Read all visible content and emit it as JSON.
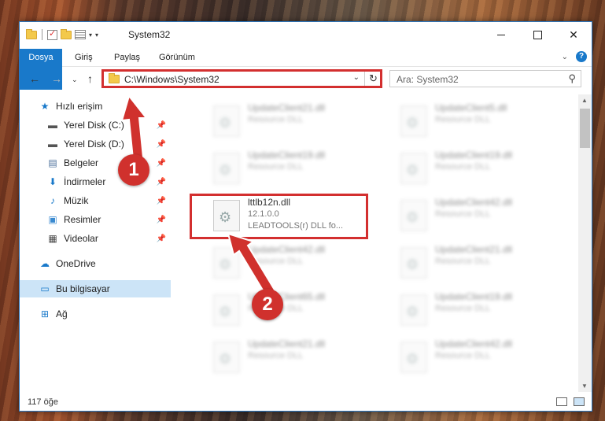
{
  "window": {
    "title": "System32",
    "accent": "#1979ca",
    "highlight": "#d32f2f"
  },
  "ribbon": {
    "tabs": [
      "Dosya",
      "Giriş",
      "Paylaş",
      "Görünüm"
    ],
    "help": "?"
  },
  "nav": {
    "address": "C:\\Windows\\System32",
    "search_placeholder": "Ara: System32"
  },
  "sidebar": {
    "items": [
      {
        "label": "Hızlı erişim",
        "icon": "star-icon"
      },
      {
        "label": "Yerel Disk (C:)",
        "icon": "drive-icon"
      },
      {
        "label": "Yerel Disk (D:)",
        "icon": "drive-icon"
      },
      {
        "label": "Belgeler",
        "icon": "documents-icon"
      },
      {
        "label": "İndirmeler",
        "icon": "download-icon"
      },
      {
        "label": "Müzik",
        "icon": "music-icon"
      },
      {
        "label": "Resimler",
        "icon": "pictures-icon"
      },
      {
        "label": "Videolar",
        "icon": "video-icon"
      },
      {
        "label": "OneDrive",
        "icon": "cloud-icon"
      },
      {
        "label": "Bu bilgisayar",
        "icon": "computer-icon"
      },
      {
        "label": "Ağ",
        "icon": "network-icon"
      }
    ]
  },
  "files": [
    {
      "name": "UpdateClient21.dll",
      "desc": "Resource DLL"
    },
    {
      "name": "UpdateClient5.dll",
      "desc": "Resource DLL"
    },
    {
      "name": "UpdateClient19.dll",
      "desc": "Resource DLL"
    },
    {
      "name": "UpdateClient19.dll",
      "desc": "Resource DLL"
    },
    {
      "name": "lttlb12n.dll",
      "desc": "12.1.0.0",
      "desc2": "LEADTOOLS(r) DLL fo..."
    },
    {
      "name": "UpdateClient42.dll",
      "desc": "Resource DLL"
    },
    {
      "name": "UpdateClient42.dll",
      "desc": "Resource DLL"
    },
    {
      "name": "UpdateClient21.dll",
      "desc": "Resource DLL"
    },
    {
      "name": "UpdateClient65.dll",
      "desc": "Resource DLL"
    },
    {
      "name": "UpdateClient19.dll",
      "desc": "Resource DLL"
    },
    {
      "name": "UpdateClient21.dll",
      "desc": "Resource DLL"
    },
    {
      "name": "UpdateClient42.dll",
      "desc": "Resource DLL"
    }
  ],
  "status": {
    "count": "117 öğe"
  },
  "markers": [
    "1",
    "2"
  ]
}
